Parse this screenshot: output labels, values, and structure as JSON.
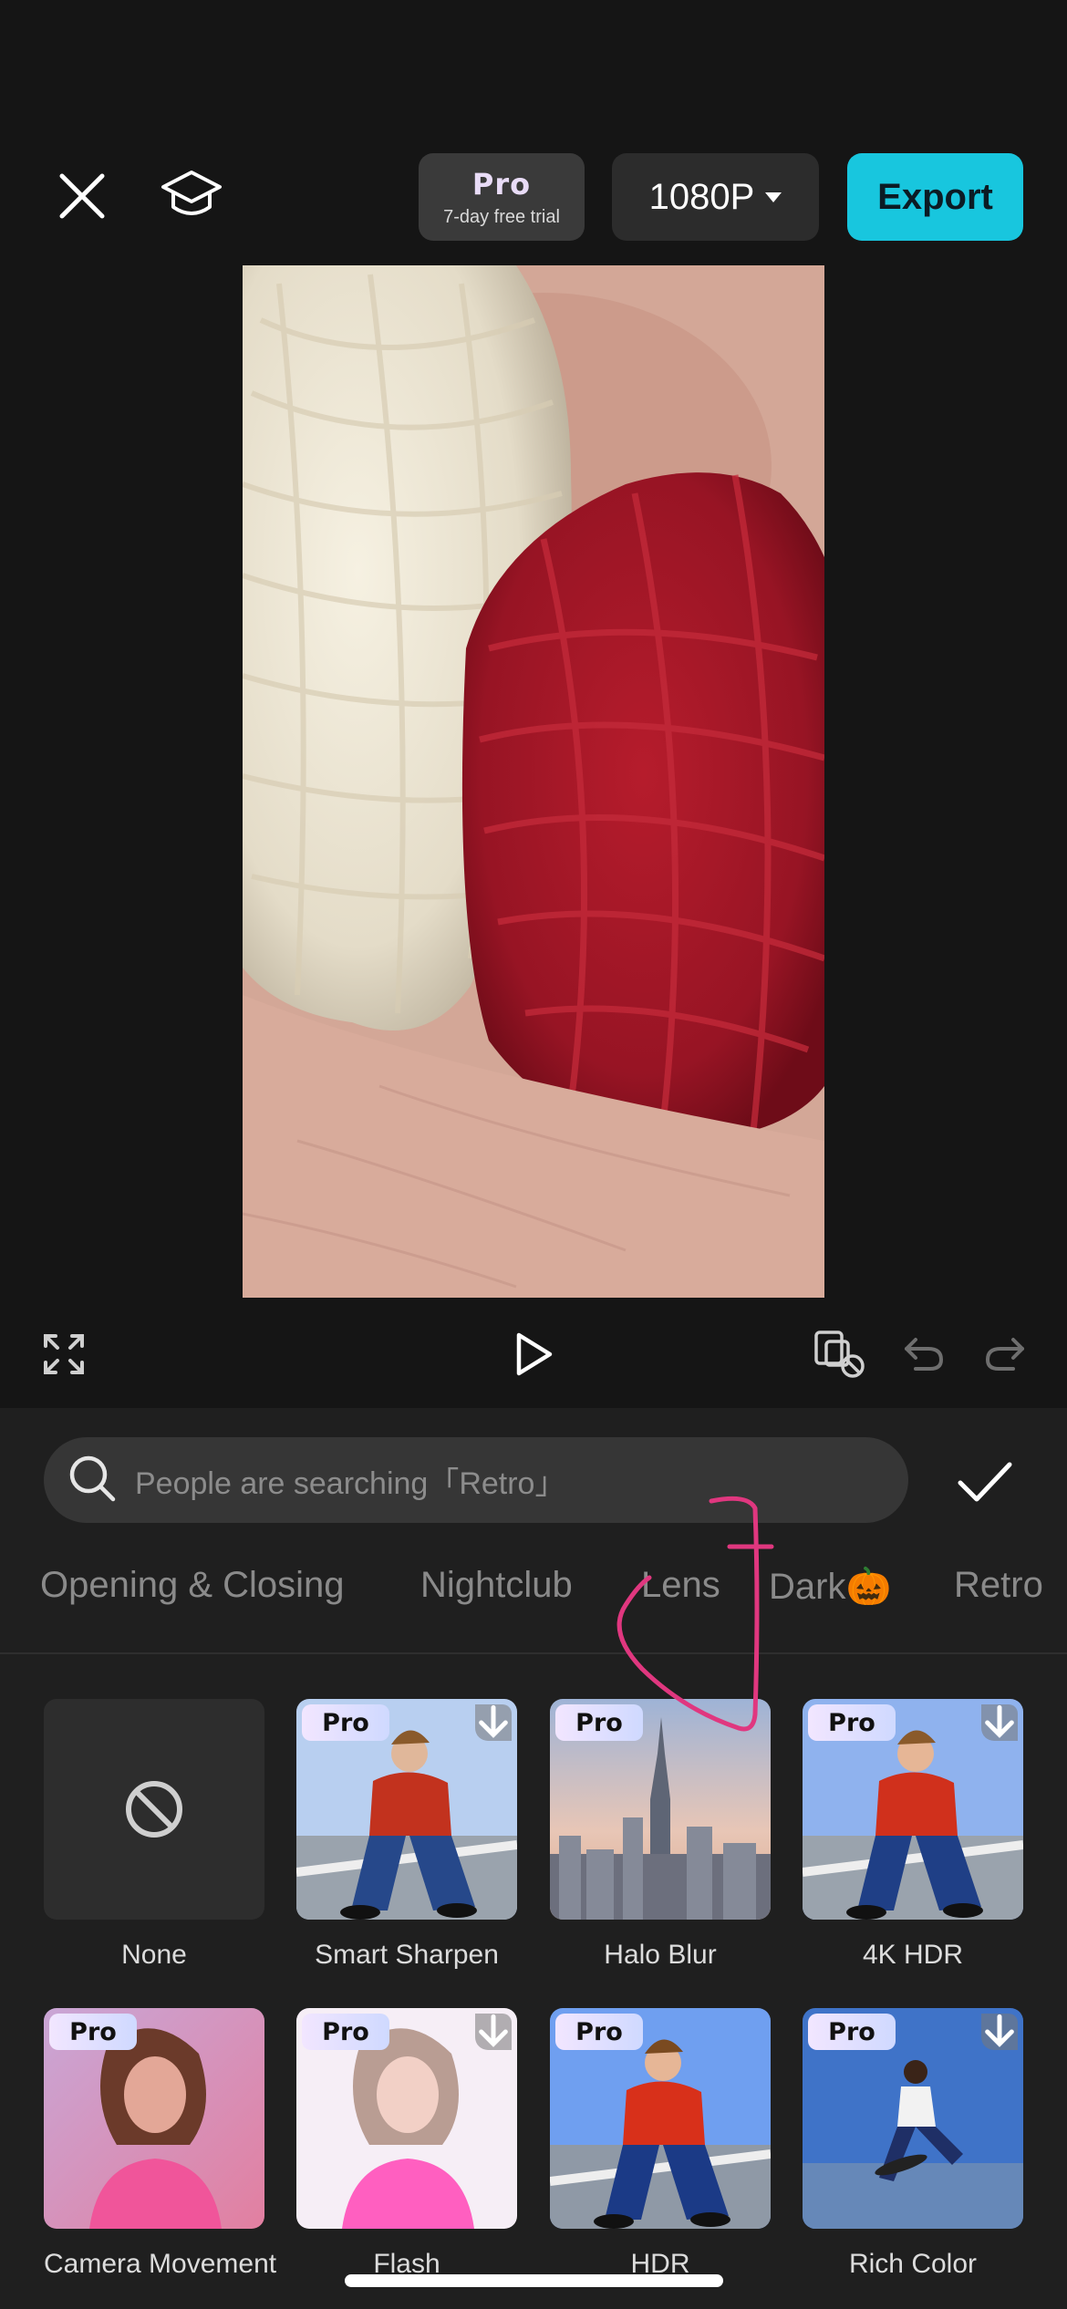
{
  "topbar": {
    "close_icon": "close-icon",
    "tutorial_icon": "graduation-cap-icon",
    "pro_label": "Pro",
    "trial_label": "7-day free trial",
    "resolution": "1080P",
    "export_label": "Export"
  },
  "controls": {
    "icons": [
      "fullscreen-icon",
      "play-icon",
      "magic-edit-icon",
      "undo-icon",
      "redo-icon"
    ]
  },
  "search": {
    "placeholder": "People are searching「Retro」",
    "icon": "search-icon",
    "confirm_icon": "checkmark-icon"
  },
  "tabs": [
    {
      "label": "Opening & Closing"
    },
    {
      "label": "Nightclub"
    },
    {
      "label": "Lens"
    },
    {
      "label": "Dark🎃"
    },
    {
      "label": "Retro"
    }
  ],
  "effects": [
    {
      "label": "None",
      "pro": false
    },
    {
      "label": "Smart Sharpen",
      "pro": true,
      "pro_text": "Pro"
    },
    {
      "label": "Halo Blur",
      "pro": true,
      "pro_text": "Pro"
    },
    {
      "label": "4K HDR",
      "pro": true,
      "pro_text": "Pro"
    },
    {
      "label": "Camera Movement",
      "pro": true,
      "pro_text": "Pro"
    },
    {
      "label": "Flash",
      "pro": true,
      "pro_text": "Pro"
    },
    {
      "label": "HDR",
      "pro": true,
      "pro_text": "Pro"
    },
    {
      "label": "Rich Color",
      "pro": true,
      "pro_text": "Pro"
    }
  ],
  "colors": {
    "accent": "#18c6de",
    "annotation": "#e0377f"
  }
}
